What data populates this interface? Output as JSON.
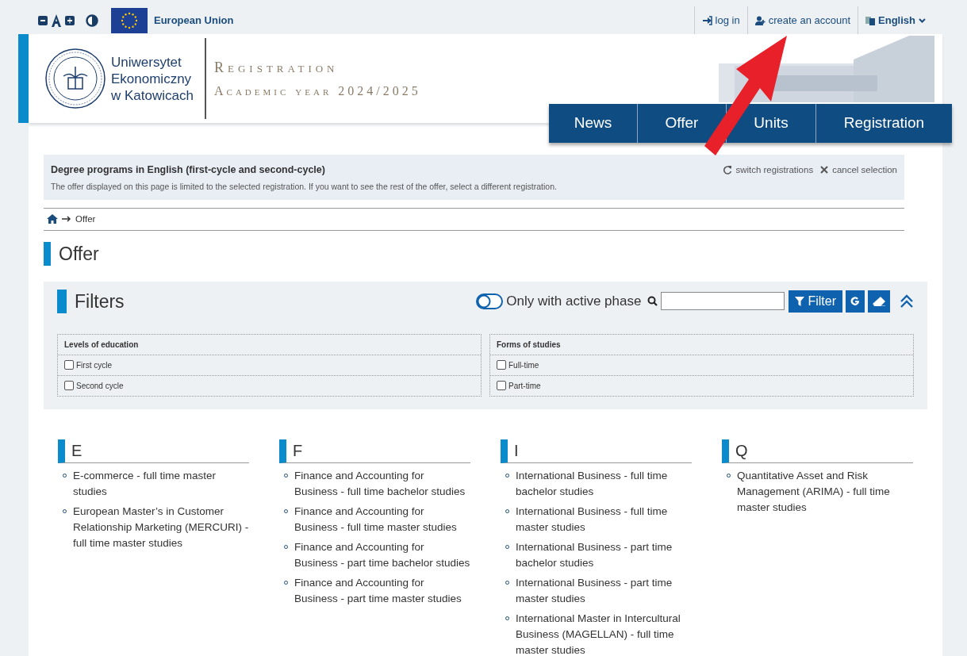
{
  "top_bar": {
    "eu_label": "European Union",
    "links": [
      {
        "label": "log in"
      },
      {
        "label": "create an account"
      }
    ],
    "language": "English"
  },
  "header": {
    "university": [
      "Uniwersytet",
      "Ekonomiczny",
      "w Katowicach"
    ],
    "title": "Registration",
    "subtitle": "Academic year 2024/2025"
  },
  "nav": [
    {
      "label": "News"
    },
    {
      "label": "Offer"
    },
    {
      "label": "Units"
    },
    {
      "label": "Registration"
    }
  ],
  "notice": {
    "title": "Degree programs in English (first-cycle and second-cycle)",
    "text": "The offer displayed on this page is limited to the selected registration. If you want to see the rest of the offer, select a different registration.",
    "actions": [
      {
        "label": "switch registrations"
      },
      {
        "label": "cancel selection"
      }
    ]
  },
  "breadcrumb": [
    "Offer"
  ],
  "page_title": "Offer",
  "filters": {
    "title": "Filters",
    "toggle": {
      "label": "Only with active phase",
      "on": false
    },
    "filter_button": "Filter",
    "groups": [
      {
        "title": "Levels of education",
        "options": [
          {
            "label": "First cycle",
            "checked": false
          },
          {
            "label": "Second cycle",
            "checked": false
          }
        ]
      },
      {
        "title": "Forms of studies",
        "options": [
          {
            "label": "Full-time",
            "checked": false
          },
          {
            "label": "Part-time",
            "checked": false
          }
        ]
      }
    ]
  },
  "programs": [
    {
      "letter": "E",
      "items": [
        "E-commerce - full time master studies",
        "European Master’s in Customer Relationship Marketing (MERCURI) - full time master studies"
      ]
    },
    {
      "letter": "F",
      "items": [
        "Finance and Accounting for Business - full time bachelor studies",
        "Finance and Accounting for Business - full time master studies",
        "Finance and Accounting for Business - part time bachelor studies",
        "Finance and Accounting for Business - part time master studies"
      ]
    },
    {
      "letter": "I",
      "items": [
        "International Business - full time bachelor studies",
        "International Business - full time master studies",
        "International Business - part time bachelor studies",
        "International Business - part time master studies",
        "International Master in Intercultural Business (MAGELLAN) - full time master studies"
      ]
    },
    {
      "letter": "Q",
      "items": [
        "Quantitative Asset and Risk Management (ARIMA) - full time master studies"
      ]
    }
  ]
}
